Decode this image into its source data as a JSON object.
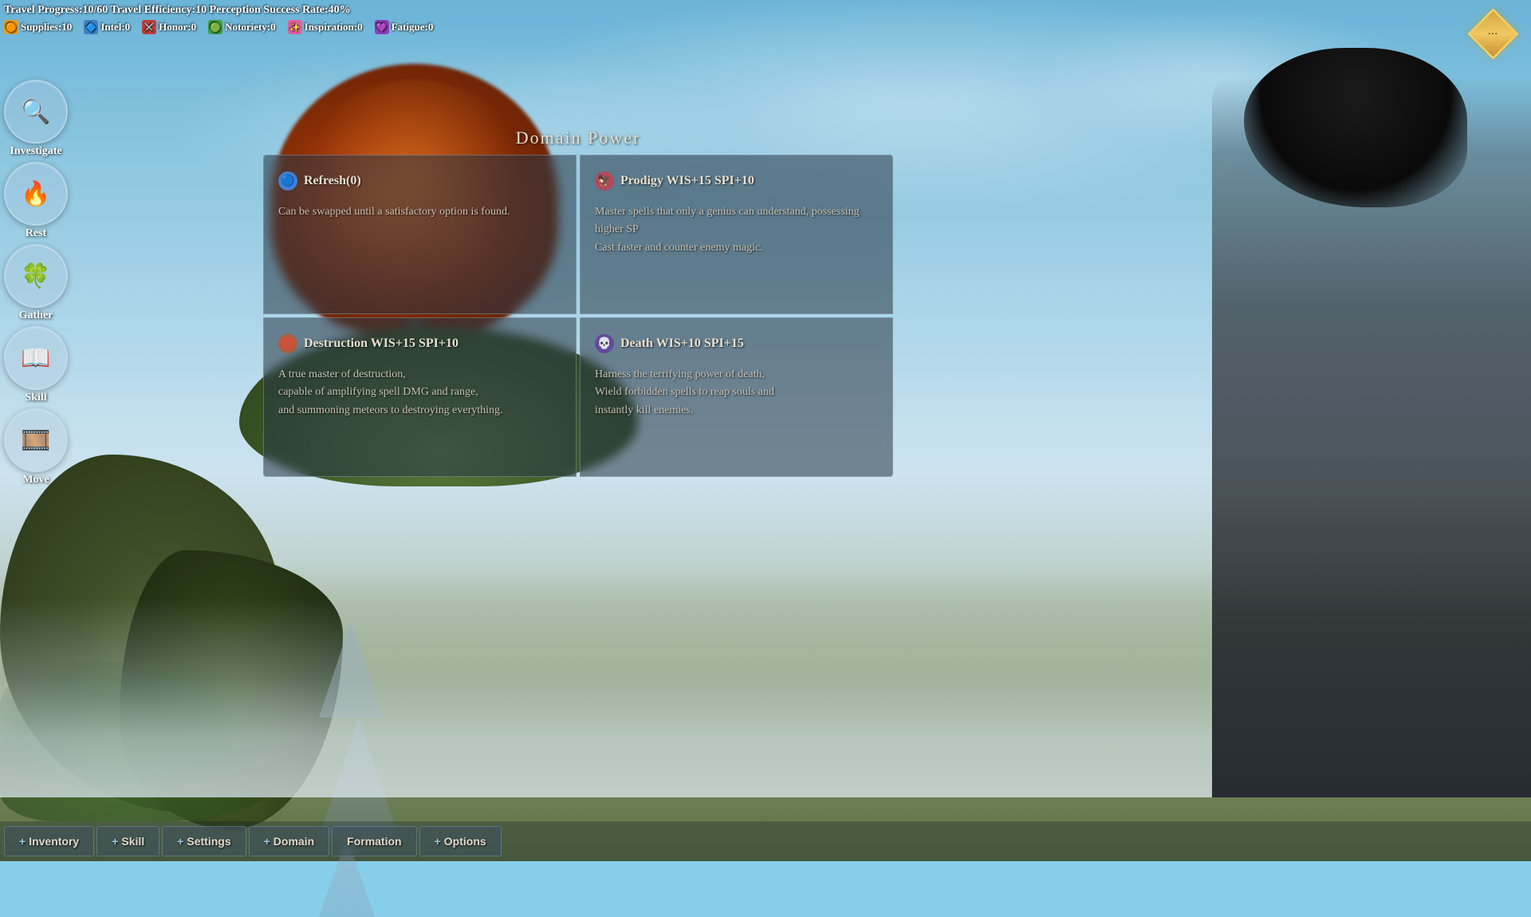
{
  "hud": {
    "travel_info": "Travel Progress:10/60 Travel Efficiency:10 Perception Success Rate:40%",
    "stats": [
      {
        "id": "supplies",
        "label": "Supplies:10",
        "icon": "🟠",
        "color_class": "supplies"
      },
      {
        "id": "intel",
        "label": "Intel:0",
        "icon": "🔷",
        "color_class": "intel"
      },
      {
        "id": "honor",
        "label": "Honor:0",
        "icon": "⚔️",
        "color_class": "honor"
      },
      {
        "id": "notoriety",
        "label": "Notoriety:0",
        "icon": "🟢",
        "color_class": "notoriety"
      },
      {
        "id": "inspiration",
        "label": "Inspiration:0",
        "icon": "✨",
        "color_class": "inspiration"
      },
      {
        "id": "fatigue",
        "label": "Fatigue:0",
        "icon": "💜",
        "color_class": "fatigue"
      }
    ]
  },
  "sidebar": {
    "actions": [
      {
        "id": "investigate",
        "label": "Investigate",
        "icon": "🔍"
      },
      {
        "id": "rest",
        "label": "Rest",
        "icon": "🔥"
      },
      {
        "id": "gather",
        "label": "Gather",
        "icon": "🍀"
      },
      {
        "id": "skill",
        "label": "Skill",
        "icon": "📖"
      },
      {
        "id": "move",
        "label": "Move",
        "icon": "🎞️"
      }
    ]
  },
  "domain_panel": {
    "title": "Domain Power",
    "cards": [
      {
        "id": "refresh",
        "title": "Refresh(0)",
        "icon": "🔵",
        "icon_class": "refresh",
        "body": "Can be swapped until a satisfactory option is found."
      },
      {
        "id": "prodigy",
        "title": "Prodigy WIS+15 SPI+10",
        "icon": "🦅",
        "icon_class": "prodigy",
        "body": "Master spells that only a genius can understand, possessing higher SP\nCast faster and counter enemy magic."
      },
      {
        "id": "destruction",
        "title": "Destruction WIS+15 SPI+10",
        "icon": "💢",
        "icon_class": "destruction",
        "body": "A true master of destruction,\ncapable of amplifying spell DMG and range,\nand summoning meteors to destroying everything."
      },
      {
        "id": "death",
        "title": "Death WIS+10 SPI+15",
        "icon": "💀",
        "icon_class": "death",
        "body": "Harness the terrifying power of death,\nWield forbidden spells to reap souls and\ninstantly kill enemies."
      }
    ]
  },
  "toolbar": {
    "buttons": [
      {
        "id": "inventory",
        "label": "+Inventory",
        "has_plus": true,
        "text": "Inventory"
      },
      {
        "id": "skill",
        "label": "+ Skill",
        "has_plus": true,
        "text": "Skill"
      },
      {
        "id": "settings",
        "label": "+ Settings",
        "has_plus": true,
        "text": "Settings"
      },
      {
        "id": "domain",
        "label": "+ Domain",
        "has_plus": true,
        "text": "Domain"
      },
      {
        "id": "formation",
        "label": "Formation",
        "has_plus": false,
        "text": "Formation"
      },
      {
        "id": "options",
        "label": "+ Options",
        "has_plus": true,
        "text": "Options"
      }
    ]
  }
}
